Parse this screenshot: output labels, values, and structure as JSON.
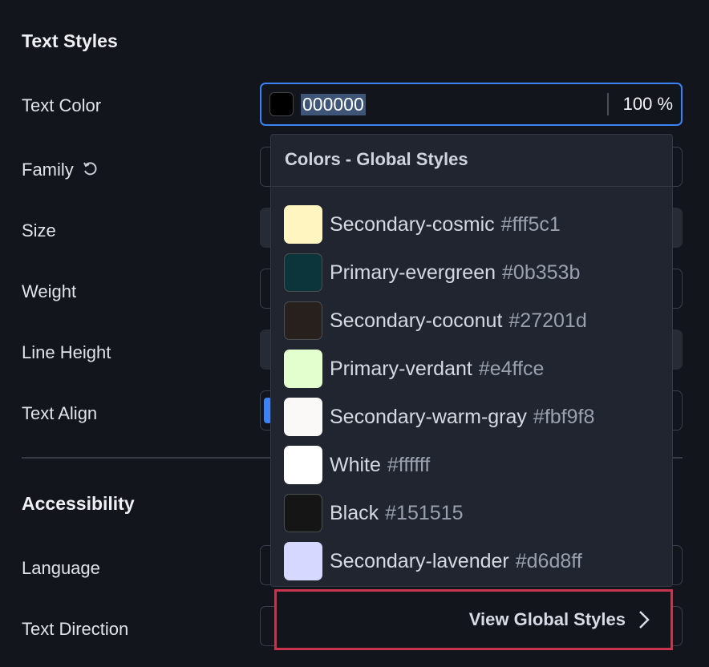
{
  "sections": {
    "text_styles": "Text Styles",
    "accessibility": "Accessibility"
  },
  "labels": {
    "text_color": "Text Color",
    "family": "Family",
    "size": "Size",
    "weight": "Weight",
    "line_height": "Line Height",
    "text_align": "Text Align",
    "language": "Language",
    "text_direction": "Text Direction"
  },
  "text_color": {
    "hex": "000000",
    "opacity": "100",
    "unit": "%",
    "swatch": "#000000"
  },
  "dropdown": {
    "title": "Colors - Global Styles",
    "items": [
      {
        "name": "Secondary-cosmic",
        "hex": "#fff5c1"
      },
      {
        "name": "Primary-evergreen",
        "hex": "#0b353b"
      },
      {
        "name": "Secondary-coconut",
        "hex": "#27201d"
      },
      {
        "name": "Primary-verdant",
        "hex": "#e4ffce"
      },
      {
        "name": "Secondary-warm-gray",
        "hex": "#fbf9f8"
      },
      {
        "name": "White",
        "hex": "#ffffff"
      },
      {
        "name": "Black",
        "hex": "#151515"
      },
      {
        "name": "Secondary-lavender",
        "hex": "#d6d8ff"
      }
    ],
    "footer": "View Global Styles"
  },
  "colors": {
    "accent": "#3b82f6",
    "highlight": "#c9344d"
  }
}
